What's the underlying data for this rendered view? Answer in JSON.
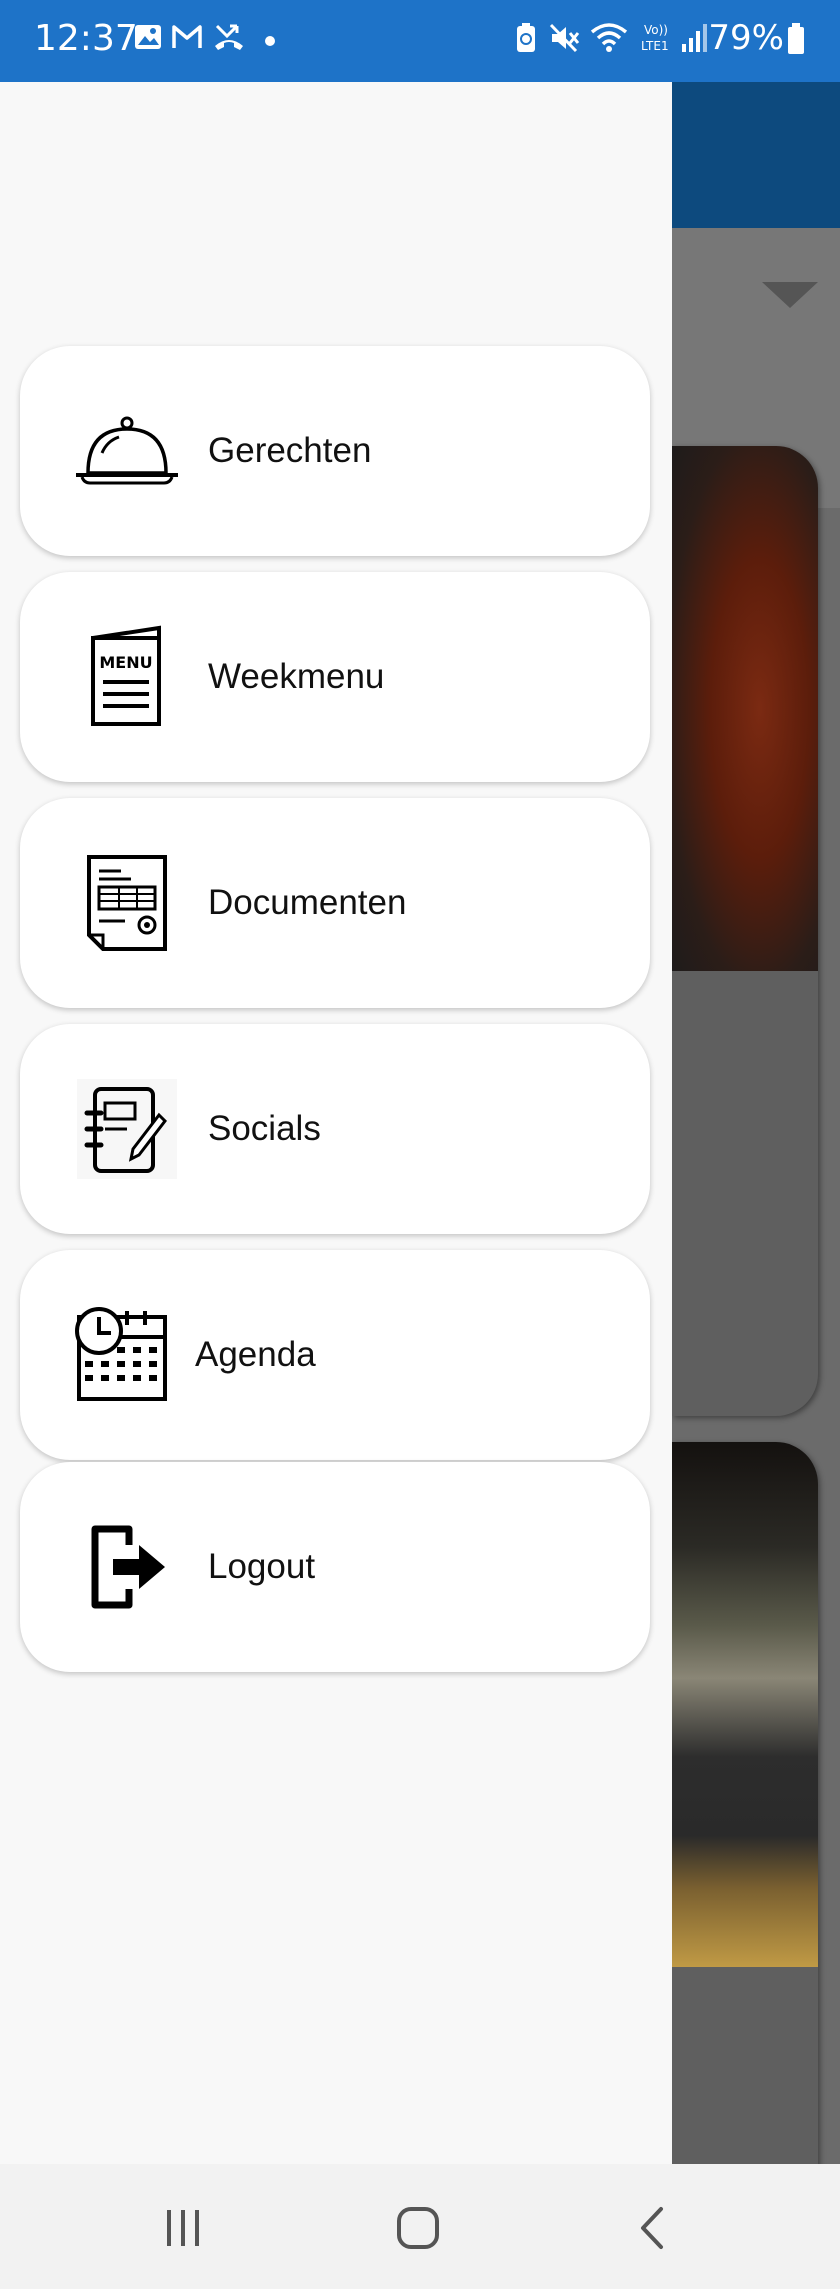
{
  "status_bar": {
    "time": "12:37",
    "battery": "79%",
    "icons": [
      "image-icon",
      "gmail-icon",
      "missed-call-icon",
      "dot-icon",
      "battery-saver-icon",
      "mute-icon",
      "wifi-icon",
      "volte-icon",
      "signal-icon",
      "battery-icon"
    ]
  },
  "drawer": {
    "items": [
      {
        "label": "Gerechten",
        "icon": "cloche-icon"
      },
      {
        "label": "Weekmenu",
        "icon": "menu-card-icon",
        "icon_text": "MENU"
      },
      {
        "label": "Documenten",
        "icon": "document-icon"
      },
      {
        "label": "Socials",
        "icon": "notebook-pen-icon"
      },
      {
        "label": "Agenda",
        "icon": "calendar-clock-icon"
      },
      {
        "label": "Logout",
        "icon": "logout-icon"
      }
    ]
  },
  "nav_bar": {
    "buttons": [
      "recent-apps-icon",
      "home-icon",
      "back-icon"
    ]
  },
  "colors": {
    "status_bar": "#1e73c8",
    "drawer_bg": "#f8f8f8",
    "item_bg": "#ffffff",
    "app_header": "#0d4a7e"
  }
}
